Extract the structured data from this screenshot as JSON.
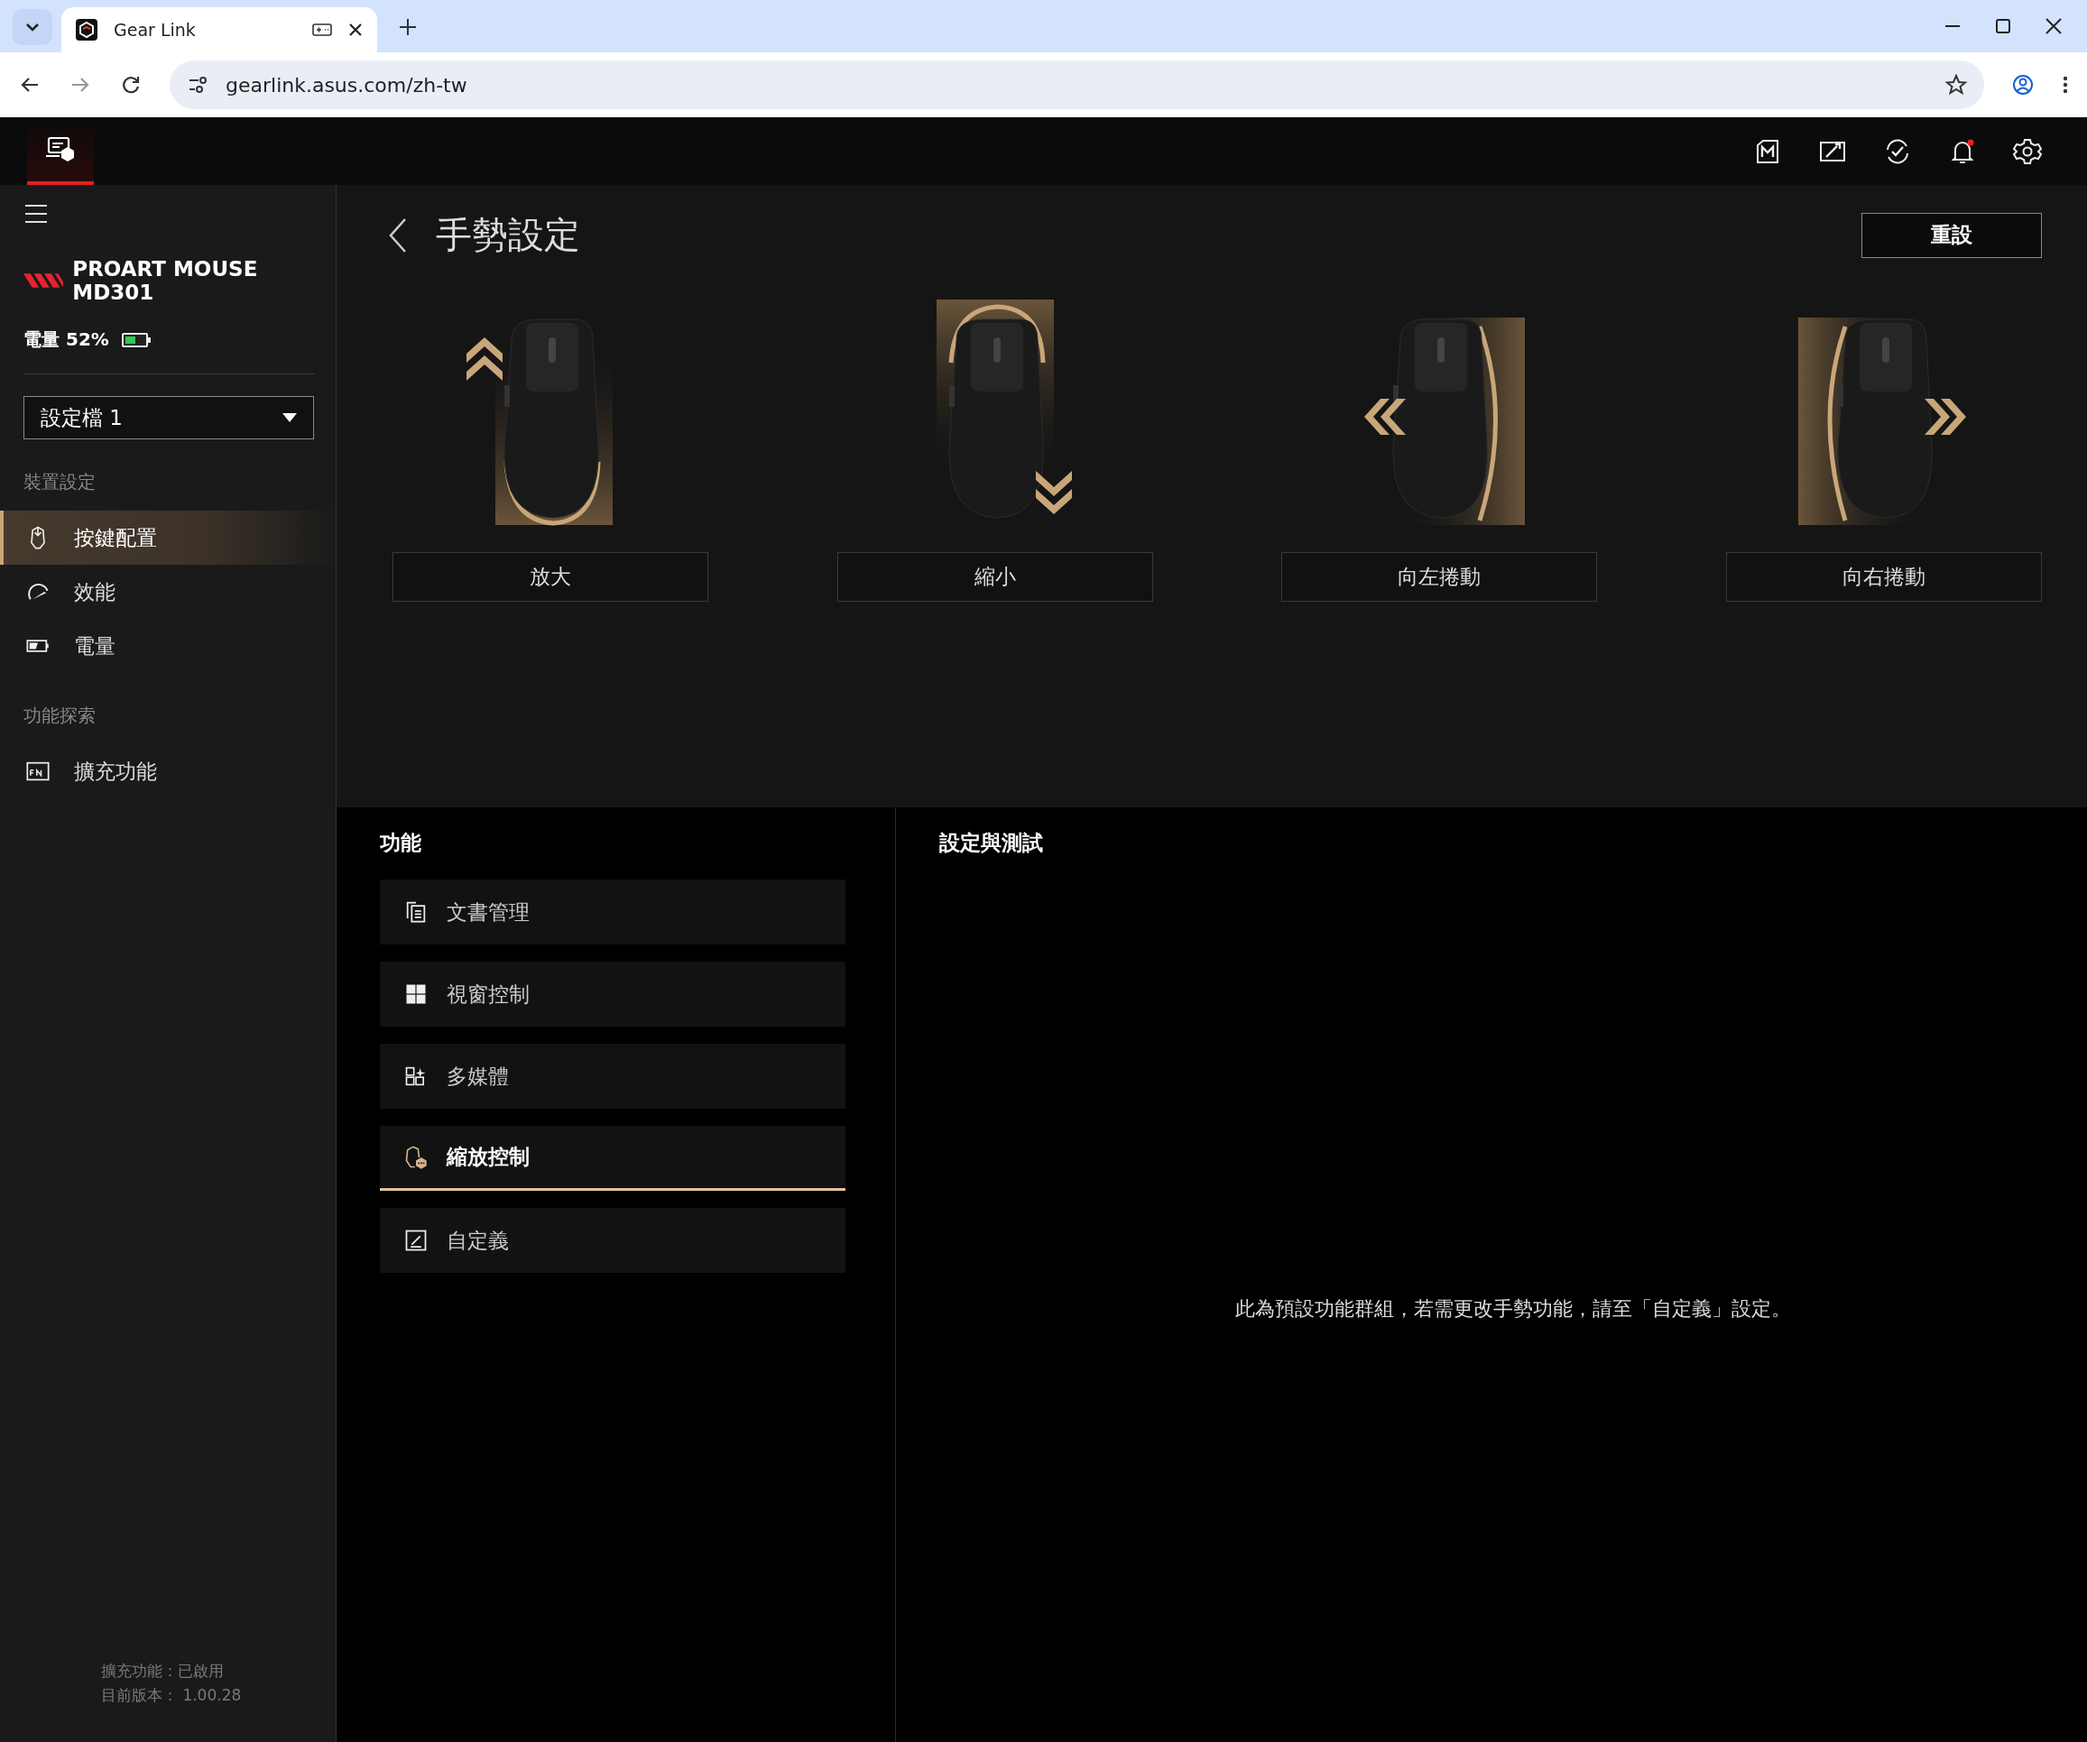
{
  "browser": {
    "tab_title": "Gear Link",
    "url": "gearlink.asus.com/zh-tw"
  },
  "sidebar": {
    "device_name": "PROART MOUSE MD301",
    "battery": "電量 52%",
    "profile": "設定檔 1",
    "sections": [
      {
        "title": "裝置設定",
        "items": [
          {
            "label": "按鍵配置",
            "kind": "mouse",
            "selected": true
          },
          {
            "label": "效能",
            "kind": "gauge",
            "selected": false
          },
          {
            "label": "電量",
            "kind": "battery",
            "selected": false
          }
        ]
      },
      {
        "title": "功能探索",
        "items": [
          {
            "label": "擴充功能",
            "kind": "fn",
            "selected": false
          }
        ]
      }
    ],
    "footer": [
      "擴充功能：已啟用",
      "目前版本： 1.00.28"
    ]
  },
  "main": {
    "title": "手勢設定",
    "reset_button": "重設",
    "gestures": [
      {
        "label": "放大",
        "kind": "up"
      },
      {
        "label": "縮小",
        "kind": "down"
      },
      {
        "label": "向左捲動",
        "kind": "left"
      },
      {
        "label": "向右捲動",
        "kind": "right"
      }
    ]
  },
  "functions": {
    "title": "功能",
    "items": [
      {
        "label": "文書管理",
        "kind": "document",
        "selected": false
      },
      {
        "label": "視窗控制",
        "kind": "windows",
        "selected": false
      },
      {
        "label": "多媒體",
        "kind": "apps",
        "selected": false
      },
      {
        "label": "縮放控制",
        "kind": "zoom",
        "selected": true
      },
      {
        "label": "自定義",
        "kind": "edit",
        "selected": false
      }
    ]
  },
  "settings": {
    "title": "設定與測試",
    "message": "此為預設功能群組，若需更改手勢功能，請至「自定義」設定。"
  }
}
